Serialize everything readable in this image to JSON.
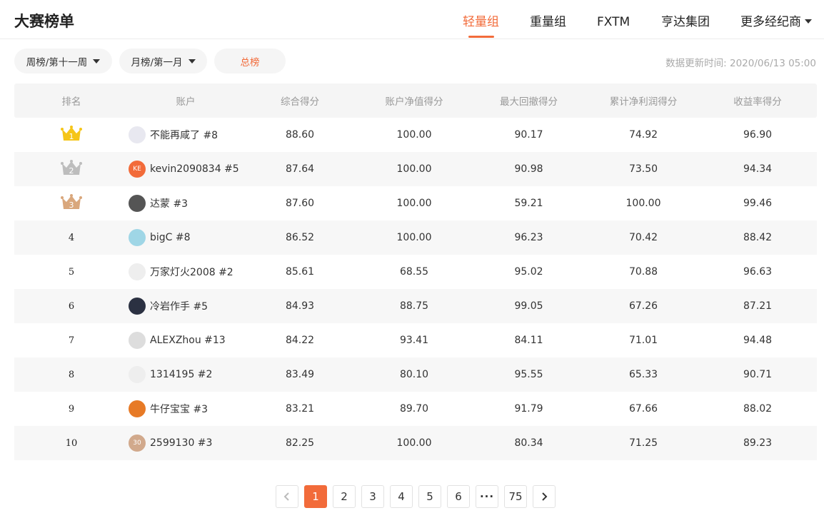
{
  "header": {
    "title": "大赛榜单",
    "tabs": [
      "轻量组",
      "重量组",
      "FXTM",
      "亨达集团",
      "更多经纪商"
    ],
    "active_tab": 0
  },
  "filters": {
    "week": "周榜/第十一周",
    "month": "月榜/第一月",
    "total": "总榜"
  },
  "update_time": "数据更新时间: 2020/06/13 05:00",
  "colors": {
    "accent": "#f26b3a",
    "gold": "#f5c518",
    "silver": "#bdbdbd",
    "bronze": "#d9a77c"
  },
  "table": {
    "headers": [
      "排名",
      "账户",
      "综合得分",
      "账户净值得分",
      "最大回撤得分",
      "累计净利润得分",
      "收益率得分"
    ],
    "rows": [
      {
        "rank": "1",
        "account": "不能再咸了 #8",
        "score": "88.60",
        "net": "100.00",
        "drawdown": "90.17",
        "profit": "74.92",
        "yield": "96.90"
      },
      {
        "rank": "2",
        "account": "kevin2090834 #5",
        "avatar_text": "KE",
        "score": "87.64",
        "net": "100.00",
        "drawdown": "90.98",
        "profit": "73.50",
        "yield": "94.34"
      },
      {
        "rank": "3",
        "account": "达蒙 #3",
        "score": "87.60",
        "net": "100.00",
        "drawdown": "59.21",
        "profit": "100.00",
        "yield": "99.46"
      },
      {
        "rank": "4",
        "account": "bigC #8",
        "score": "86.52",
        "net": "100.00",
        "drawdown": "96.23",
        "profit": "70.42",
        "yield": "88.42"
      },
      {
        "rank": "5",
        "account": "万家灯火2008 #2",
        "score": "85.61",
        "net": "68.55",
        "drawdown": "95.02",
        "profit": "70.88",
        "yield": "96.63"
      },
      {
        "rank": "6",
        "account": "冷岩作手 #5",
        "score": "84.93",
        "net": "88.75",
        "drawdown": "99.05",
        "profit": "67.26",
        "yield": "87.21"
      },
      {
        "rank": "7",
        "account": "ALEXZhou #13",
        "score": "84.22",
        "net": "93.41",
        "drawdown": "84.11",
        "profit": "71.01",
        "yield": "94.48"
      },
      {
        "rank": "8",
        "account": "1314195 #2",
        "score": "83.49",
        "net": "80.10",
        "drawdown": "95.55",
        "profit": "65.33",
        "yield": "90.71"
      },
      {
        "rank": "9",
        "account": "牛仔宝宝 #3",
        "score": "83.21",
        "net": "89.70",
        "drawdown": "91.79",
        "profit": "67.66",
        "yield": "88.02"
      },
      {
        "rank": "10",
        "account": "2599130 #3",
        "avatar_text": "30",
        "score": "82.25",
        "net": "100.00",
        "drawdown": "80.34",
        "profit": "71.25",
        "yield": "89.23"
      }
    ]
  },
  "pagination": {
    "pages": [
      "1",
      "2",
      "3",
      "4",
      "5",
      "6"
    ],
    "ellipsis": "···",
    "last": "75",
    "current": "1"
  }
}
